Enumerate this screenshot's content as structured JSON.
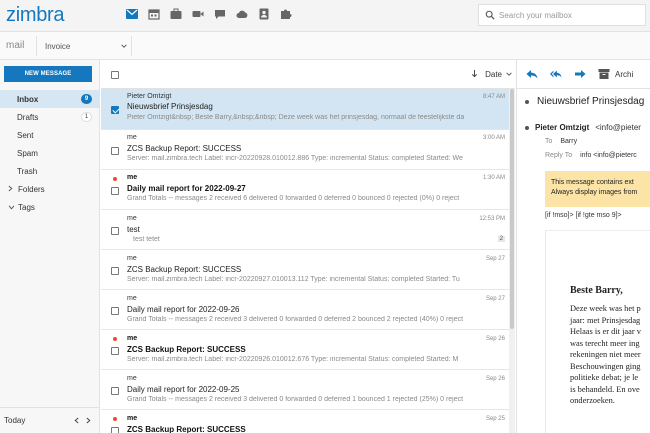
{
  "app": {
    "logo": "zimbra",
    "name": "mail",
    "apps": [
      {
        "icon": "mail-icon",
        "active": true
      },
      {
        "icon": "calendar-icon",
        "active": false
      },
      {
        "icon": "briefcase-icon",
        "active": false
      },
      {
        "icon": "video-icon",
        "active": false
      },
      {
        "icon": "chat-icon",
        "active": false
      },
      {
        "icon": "cloud-icon",
        "active": false
      },
      {
        "icon": "contacts-icon",
        "active": false
      },
      {
        "icon": "puzzle-icon",
        "active": false
      }
    ],
    "accent": "#1578be"
  },
  "search": {
    "placeholder": "Search your mailbox"
  },
  "folder_select": {
    "value": "Invoice"
  },
  "sidebar": {
    "new_message": "NEW MESSAGE",
    "folders": [
      {
        "label": "Inbox",
        "badge": "9",
        "active": true
      },
      {
        "label": "Drafts",
        "badge": "1"
      },
      {
        "label": "Sent"
      },
      {
        "label": "Spam"
      },
      {
        "label": "Trash"
      }
    ],
    "groups": [
      {
        "label": "Folders"
      },
      {
        "label": "Tags"
      }
    ],
    "footer": {
      "label": "Today"
    }
  },
  "list": {
    "sort_label": "Date",
    "messages": [
      {
        "sender": "Pieter Omtzigt",
        "subject": "Nieuwsbrief Prinsjesdag",
        "preview": "Pieter Omtzigt&nbsp; Beste Barry,&nbsp;&nbsp; Deze week was het prinsjesdag, normaal de feestelijkste da",
        "time": "8:47 AM",
        "selected": true,
        "unread": false
      },
      {
        "sender": "me",
        "subject": "ZCS Backup Report: SUCCESS",
        "preview": "Server: mail.zimbra.tech Label: incr-20220928.010012.886 Type: incremental Status: completed Started: We",
        "time": "3:00 AM"
      },
      {
        "sender": "me",
        "subject": "Daily mail report for 2022-09-27",
        "preview": "Grand Totals -- messages 2 received 6 delivered 0 forwarded 0 deferred 0 bounced 0 rejected (0%) 0 reject",
        "time": "1:30 AM",
        "unread": true
      },
      {
        "sender": "me",
        "subject": "test",
        "preview": "test tetet",
        "time": "12:53 PM",
        "count": "2"
      },
      {
        "sender": "me",
        "subject": "ZCS Backup Report: SUCCESS",
        "preview": "Server: mail.zimbra.tech Label: incr-20220927.010013.112 Type: incremental Status: completed Started: Tu",
        "time": "Sep 27"
      },
      {
        "sender": "me",
        "subject": "Daily mail report for 2022-09-26",
        "preview": "Grand Totals -- messages 2 received 3 delivered 0 forwarded 0 deferred 2 bounced 2 rejected (40%) 0 reject",
        "time": "Sep 27"
      },
      {
        "sender": "me",
        "subject": "ZCS Backup Report: SUCCESS",
        "preview": "Server: mail.zimbra.tech Label: incr-20220926.010012.676 Type: incremental Status: completed Started: M",
        "time": "Sep 26",
        "unread": true
      },
      {
        "sender": "me",
        "subject": "Daily mail report for 2022-09-25",
        "preview": "Grand Totals -- messages 2 received 3 delivered 0 forwarded 0 deferred 1 bounced 1 rejected (25%) 0 reject",
        "time": "Sep 26"
      },
      {
        "sender": "me",
        "subject": "ZCS Backup Report: SUCCESS",
        "preview": "",
        "time": "Sep 25",
        "unread": true
      }
    ]
  },
  "reading": {
    "archive_label": "Archi",
    "subject": "Nieuwsbrief Prinsjesdag",
    "from_name": "Pieter Omtzigt",
    "from_email": "<info@pieter",
    "to_label": "To",
    "to_value": "Barry",
    "reply_label": "Reply To",
    "reply_value": "info <info@pieterc",
    "warning_line1": "This message contains ext",
    "warning_line2": "Always display images from",
    "code_line": "[if !mso]> [if !gte mso 9]>",
    "greeting": "Beste Barry,",
    "body_lines": [
      "Deze week was het p",
      "jaar: met Prinsjesdag",
      "Helaas is er dit jaar v",
      "was terecht meer ing",
      "rekeningen niet meer",
      "Beschouwingen ging",
      "politieke debat; je le",
      "is behandeld. En ove",
      "onderzoeken."
    ]
  }
}
